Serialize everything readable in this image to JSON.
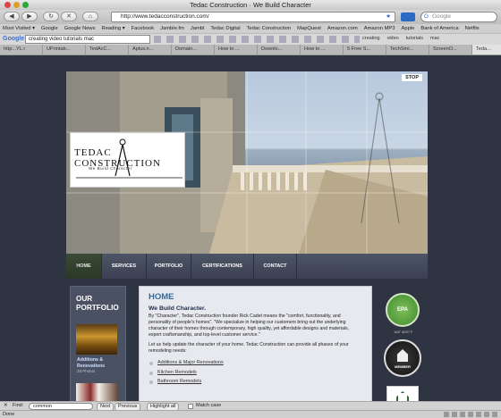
{
  "window": {
    "title": "Tedac Construction · We Build Character"
  },
  "nav": {
    "url": "http://www.tedacconstruction.com/",
    "search_placeholder": "Google"
  },
  "bookmarks": [
    "Most Visited ▾",
    "Google",
    "Google News",
    "Reading ▾",
    "Facebook",
    "Jamble.fm",
    "Jambl",
    "Tedac Digital",
    "Tedac Construction",
    "MapQuest",
    "Amazon.com",
    "Amazon MP3",
    "Apple",
    "Bank of America",
    "Netflix"
  ],
  "google_bar": {
    "search_value": "creating video tutorials mac",
    "items": [
      "creating",
      "video",
      "tutorials",
      "mac"
    ]
  },
  "tabs": [
    "http...YL.r",
    "UPrintab...",
    "TedAcC...",
    "Aplus.n...",
    "Domain...",
    "How to ...",
    "Downlo...",
    "How to ...",
    "5 Free S...",
    "TechSmi...",
    "ScreenO...",
    "Teda..."
  ],
  "page": {
    "stop_label": "STOP",
    "logo": {
      "name": "TEDAC CONSTRUCTION",
      "tagline": "We Build Character"
    },
    "menu": [
      "HOME",
      "SERVICES",
      "PORTFOLIO",
      "CERTIFICATIONS",
      "CONTACT"
    ],
    "portfolio": {
      "heading_line1": "OUR",
      "heading_line2": "PORTFOLIO",
      "item_title_line1": "Additions &",
      "item_title_line2": "Renovations",
      "item_count": "28 Photos"
    },
    "main": {
      "heading": "HOME",
      "subheading": "We Build Character.",
      "para1": "By \"Character\", Tedac Construction founder Rick Cadet means the \"comfort, functionality, and personality of people's homes\". \"We specialize in helping our customers bring out the underlying character of their homes through contemporary, high quality, yet affordable designs and materials, expert craftsmanship, and top-level customer service.\"",
      "para2": "Let us help update the character of your home. Tedac Construction can provide all phases of your remodeling needs:",
      "services": [
        "Additions & Major Renovations",
        "Kitchen Remodels",
        "Bathroom Remodels"
      ]
    },
    "badges": {
      "epa": "EPA",
      "epa_sub": "NAT 4D07 F",
      "green": "MEMBER"
    }
  },
  "find": {
    "label": "Find:",
    "value": "common",
    "next": "Next",
    "previous": "Previous",
    "highlight": "Highlight all",
    "match_case": "Match case"
  },
  "status": {
    "text": "Done"
  }
}
